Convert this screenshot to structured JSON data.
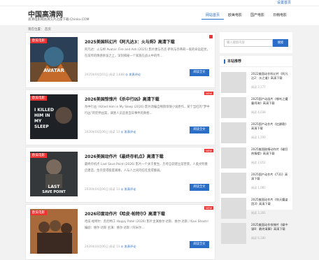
{
  "topbar": {
    "link": "设置首页"
  },
  "header": {
    "logo": "中国高清网",
    "tagline": "高清电影网高清久片迅雷下载-Chinkx.COM",
    "nav": [
      "网站首页",
      "欧美电影",
      "国产电影",
      "日韩电影"
    ]
  },
  "breadcrumb": "现在位置： 首页",
  "articles": [
    {
      "category": "欧美电影",
      "title": "2025美国科幻片《阿凡达3：火与烬》高清下载",
      "desc": "阿凡达：火与烬 Avatar: Fire and Ash (2025) 影片便与杰克·萨利与奈蒂莉一家的命运起伏，在前传的情感余波之上，深刻揭秘一个家族在战火中的传…",
      "date": "2025年04月01日",
      "views_label": "阅读 1,688",
      "comment_label": "发表评论",
      "more": "阅读全文",
      "badge": "",
      "poster_text": "AVATAR"
    },
    {
      "category": "欧美电影",
      "title": "2026美国惊悚片《杀中行凶》高清下载",
      "desc": "杀中行凶 I Killed Him in My Sleep (2026) 影片改编自畅销惊悚小说原作，某个当红的“梦中行凶”的犯伸凶案，调查人员追查当日事件的真相…",
      "date": "2026年04月06日",
      "views_label": "阅读 13",
      "comment_label": "发表评论",
      "more": "阅读全文",
      "badge": "NEW",
      "poster_text": "I KILLED HIM IN MY SLEEP"
    },
    {
      "category": "欧美电影",
      "title": "2026美国动作片《最终存机点》高清下载",
      "desc": "最终存机点 Last Save Point (2026) 影片一个关于重生、历考自获建立前营景，人类文明重启建造，生存变得极度艰难，人与人之间的信任变得脆弱。",
      "date": "2026年04月06日",
      "views_label": "阅读 13",
      "comment_label": "发表评论",
      "more": "阅读全文",
      "badge": "NEW",
      "poster_text": "LAST SAVE POINT"
    },
    {
      "category": "欧美电影",
      "title": "2026印度动作片《哈皮·帕特尔》高清下载",
      "desc": "哈皮·帕特尔：危险特工 Happy Patel (2026) 影片主演维尔·达斯、维尔·达斯 / Kavi Shastri 编剧：维尔·达斯 主演：维尔·达斯 / 阿米尔…",
      "date": "2026年04月06日",
      "views_label": "阅读 13",
      "comment_label": "发表评论",
      "more": "阅读全文",
      "badge": "NEW",
      "poster_text": ""
    }
  ],
  "search": {
    "placeholder": "输入搜索内容",
    "button": "搜索"
  },
  "recommend": {
    "heading": "本站推荐",
    "items": [
      {
        "title": "2022美国动作科幻片《阿凡达2：水之道》高清下载",
        "views": "阅读 3,177"
      },
      {
        "title": "2025国产动画片《哪吒之魔童闹海》高清下载",
        "views": "阅读 4,038"
      },
      {
        "title": "2025国产动作片《红爵歌》高清下载",
        "views": "阅读 1,700"
      },
      {
        "title": "2025美国剧情动作片《碟狂热情楼》高清下载",
        "views": "阅读 2,052"
      },
      {
        "title": "2025国产动作片《731》高清下载",
        "views": "阅读 1,085"
      },
      {
        "title": "2025美国动作片《惊天魔盗团3》高清下载",
        "views": "阅读 3,281"
      },
      {
        "title": "2025美国动作惊悚片《碟中谍8：最终清算》高清下载",
        "views": "阅读 6,180"
      }
    ]
  },
  "colors": {
    "accent": "#2a6ec8",
    "badge": "#e33333"
  }
}
